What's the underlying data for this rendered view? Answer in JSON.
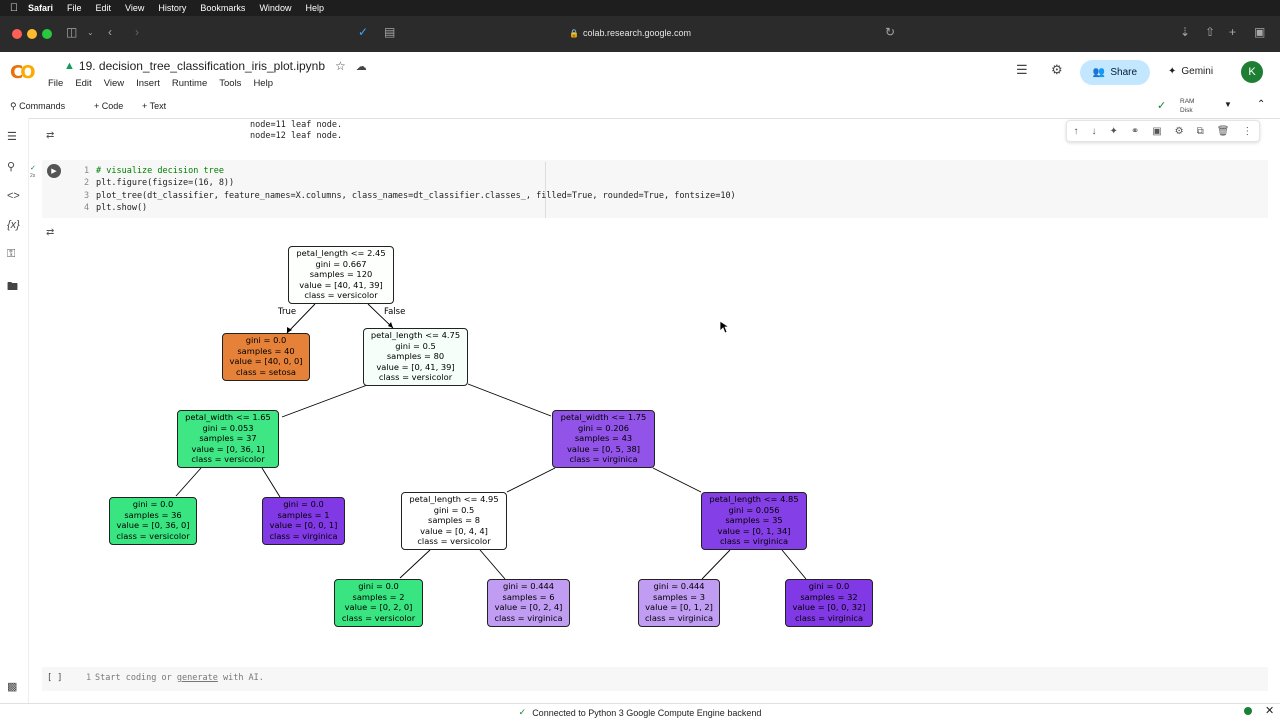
{
  "menubar": {
    "app": "Safari",
    "items": [
      "File",
      "Edit",
      "View",
      "History",
      "Bookmarks",
      "Window",
      "Help"
    ]
  },
  "safari": {
    "url": "colab.research.google.com"
  },
  "colab": {
    "title": "19. decision_tree_classification_iris_plot.ipynb",
    "menus": [
      "File",
      "Edit",
      "View",
      "Insert",
      "Runtime",
      "Tools",
      "Help"
    ],
    "share_label": "Share",
    "gemini_label": "Gemini",
    "avatar_letter": "K",
    "commands_label": "Commands",
    "code_label": "+ Code",
    "text_label": "+ Text",
    "ram_label": "RAM",
    "disk_label": "Disk"
  },
  "prev_output": [
    "node=11 leaf node.",
    "node=12 leaf node."
  ],
  "code": {
    "lines": [
      {
        "n": "1",
        "text": "# visualize decision tree"
      },
      {
        "n": "2",
        "text": "plt.figure(figsize=(16, 8))"
      },
      {
        "n": "3",
        "text": "plot_tree(dt_classifier, feature_names=X.columns, class_names=dt_classifier.classes_, filled=True, rounded=True, fontsize=10)"
      },
      {
        "n": "4",
        "text": "plt.show()"
      }
    ],
    "exec_count": "2s"
  },
  "tree": {
    "nodes": [
      {
        "id": "n0",
        "lines": [
          "petal_length <= 2.45",
          "gini = 0.667",
          "samples = 120",
          "value = [40, 41, 39]",
          "class = versicolor"
        ],
        "color": "#fdfffd"
      },
      {
        "id": "n1",
        "lines": [
          "gini = 0.0",
          "samples = 40",
          "value = [40, 0, 0]",
          "class = setosa"
        ],
        "color": "#e58139"
      },
      {
        "id": "n2",
        "lines": [
          "petal_length <= 4.75",
          "gini = 0.5",
          "samples = 80",
          "value = [0, 41, 39]",
          "class = versicolor"
        ],
        "color": "#f5fef9"
      },
      {
        "id": "n3",
        "lines": [
          "petal_width <= 1.65",
          "gini = 0.053",
          "samples = 37",
          "value = [0, 36, 1]",
          "class = versicolor"
        ],
        "color": "#3ee684"
      },
      {
        "id": "n4",
        "lines": [
          "petal_width <= 1.75",
          "gini = 0.206",
          "samples = 43",
          "value = [0, 5, 38]",
          "class = virginica"
        ],
        "color": "#9253e8"
      },
      {
        "id": "n5",
        "lines": [
          "gini = 0.0",
          "samples = 36",
          "value = [0, 36, 0]",
          "class = versicolor"
        ],
        "color": "#39e581"
      },
      {
        "id": "n6",
        "lines": [
          "gini = 0.0",
          "samples = 1",
          "value = [0, 0, 1]",
          "class = virginica"
        ],
        "color": "#8139e5"
      },
      {
        "id": "n7",
        "lines": [
          "petal_length <= 4.95",
          "gini = 0.5",
          "samples = 8",
          "value = [0, 4, 4]",
          "class = versicolor"
        ],
        "color": "#ffffff"
      },
      {
        "id": "n8",
        "lines": [
          "petal_length <= 4.85",
          "gini = 0.056",
          "samples = 35",
          "value = [0, 1, 34]",
          "class = virginica"
        ],
        "color": "#853fe6"
      },
      {
        "id": "n9",
        "lines": [
          "gini = 0.0",
          "samples = 2",
          "value = [0, 2, 0]",
          "class = versicolor"
        ],
        "color": "#39e581"
      },
      {
        "id": "n10",
        "lines": [
          "gini = 0.444",
          "samples = 6",
          "value = [0, 2, 4]",
          "class = virginica"
        ],
        "color": "#c09cf2"
      },
      {
        "id": "n11",
        "lines": [
          "gini = 0.444",
          "samples = 3",
          "value = [0, 1, 2]",
          "class = virginica"
        ],
        "color": "#c09cf2"
      },
      {
        "id": "n12",
        "lines": [
          "gini = 0.0",
          "samples = 32",
          "value = [0, 0, 32]",
          "class = virginica"
        ],
        "color": "#8139e5"
      }
    ],
    "true_label": "True",
    "false_label": "False"
  },
  "empty_cell": {
    "line_no": "1",
    "text_a": "Start coding or ",
    "link": "generate",
    "text_b": " with AI.",
    "brackets": "[ ]"
  },
  "status": {
    "text": "Connected to Python 3 Google Compute Engine backend"
  }
}
